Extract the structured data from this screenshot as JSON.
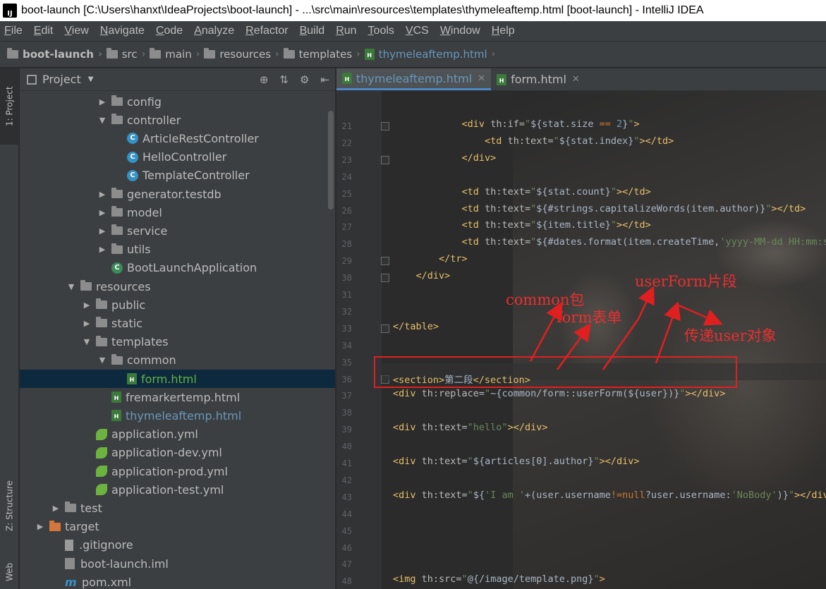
{
  "window": {
    "title": "boot-launch [C:\\Users\\hanxt\\IdeaProjects\\boot-launch] - ...\\src\\main\\resources\\templates\\thymeleaftemp.html [boot-launch] - IntelliJ IDEA"
  },
  "menu": [
    "File",
    "Edit",
    "View",
    "Navigate",
    "Code",
    "Analyze",
    "Refactor",
    "Build",
    "Run",
    "Tools",
    "VCS",
    "Window",
    "Help"
  ],
  "breadcrumb": [
    "boot-launch",
    "src",
    "main",
    "resources",
    "templates",
    "thymeleaftemp.html"
  ],
  "sidebar_tabs": {
    "project": "1: Project",
    "structure": "Z: Structure",
    "web": "Web"
  },
  "project_panel": {
    "title": "Project",
    "tree": [
      {
        "label": "config",
        "type": "folder",
        "depth": 5,
        "expanded": false
      },
      {
        "label": "controller",
        "type": "folder",
        "depth": 5,
        "expanded": true
      },
      {
        "label": "ArticleRestController",
        "type": "class",
        "depth": 6
      },
      {
        "label": "HelloController",
        "type": "class",
        "depth": 6
      },
      {
        "label": "TemplateController",
        "type": "class",
        "depth": 6
      },
      {
        "label": "generator.testdb",
        "type": "folder",
        "depth": 5,
        "expanded": false
      },
      {
        "label": "model",
        "type": "folder",
        "depth": 5,
        "expanded": false
      },
      {
        "label": "service",
        "type": "folder",
        "depth": 5,
        "expanded": false
      },
      {
        "label": "utils",
        "type": "folder",
        "depth": 5,
        "expanded": false
      },
      {
        "label": "BootLaunchApplication",
        "type": "springclass",
        "depth": 5
      },
      {
        "label": "resources",
        "type": "resfolder",
        "depth": 3,
        "expanded": true
      },
      {
        "label": "public",
        "type": "folder",
        "depth": 4,
        "expanded": false
      },
      {
        "label": "static",
        "type": "folder",
        "depth": 4,
        "expanded": false
      },
      {
        "label": "templates",
        "type": "folder",
        "depth": 4,
        "expanded": true
      },
      {
        "label": "common",
        "type": "folder",
        "depth": 5,
        "expanded": true
      },
      {
        "label": "form.html",
        "type": "html",
        "depth": 6,
        "selected": true
      },
      {
        "label": "fremarkertemp.html",
        "type": "html",
        "depth": 5
      },
      {
        "label": "thymeleaftemp.html",
        "type": "html",
        "depth": 5,
        "open": true
      },
      {
        "label": "application.yml",
        "type": "yml",
        "depth": 4
      },
      {
        "label": "application-dev.yml",
        "type": "yml",
        "depth": 4
      },
      {
        "label": "application-prod.yml",
        "type": "yml",
        "depth": 4
      },
      {
        "label": "application-test.yml",
        "type": "yml",
        "depth": 4
      },
      {
        "label": "test",
        "type": "folder",
        "depth": 2,
        "expanded": false
      },
      {
        "label": "target",
        "type": "orangefolder",
        "depth": 1,
        "expanded": false
      },
      {
        "label": ".gitignore",
        "type": "git",
        "depth": 2
      },
      {
        "label": "boot-launch.iml",
        "type": "iml",
        "depth": 2
      },
      {
        "label": "pom.xml",
        "type": "maven",
        "depth": 2
      }
    ]
  },
  "editor": {
    "tabs": [
      {
        "label": "thymeleaftemp.html",
        "active": true
      },
      {
        "label": "form.html",
        "active": false
      }
    ],
    "lines": [
      {
        "n": "21",
        "indent": "            ",
        "tokens": [
          [
            "tg",
            "<div "
          ],
          [
            "at",
            "th:if="
          ],
          [
            "st",
            "\""
          ],
          [
            "ex",
            "${stat.size "
          ],
          [
            "kw",
            "=="
          ],
          [
            "lit",
            " 2"
          ],
          [
            "ex",
            "}"
          ],
          [
            "st",
            "\""
          ],
          [
            "tg",
            ">"
          ]
        ]
      },
      {
        "n": "22",
        "indent": "                ",
        "tokens": [
          [
            "tg",
            "<td "
          ],
          [
            "at",
            "th:text="
          ],
          [
            "st",
            "\""
          ],
          [
            "ex",
            "${stat.index}"
          ],
          [
            "st",
            "\""
          ],
          [
            "tg",
            "></td>"
          ]
        ]
      },
      {
        "n": "23",
        "indent": "            ",
        "tokens": [
          [
            "tg",
            "</div>"
          ]
        ]
      },
      {
        "n": "24",
        "indent": "",
        "tokens": []
      },
      {
        "n": "25",
        "indent": "            ",
        "tokens": [
          [
            "tg",
            "<td "
          ],
          [
            "at",
            "th:text="
          ],
          [
            "st",
            "\""
          ],
          [
            "ex",
            "${stat.count}"
          ],
          [
            "st",
            "\""
          ],
          [
            "tg",
            "></td>"
          ]
        ]
      },
      {
        "n": "26",
        "indent": "            ",
        "tokens": [
          [
            "tg",
            "<td "
          ],
          [
            "at",
            "th:text="
          ],
          [
            "st",
            "\""
          ],
          [
            "ex",
            "${#strings.capitalizeWords(item.author)}"
          ],
          [
            "st",
            "\""
          ],
          [
            "tg",
            "></td>"
          ]
        ]
      },
      {
        "n": "27",
        "indent": "            ",
        "tokens": [
          [
            "tg",
            "<td "
          ],
          [
            "at",
            "th:text="
          ],
          [
            "st",
            "\""
          ],
          [
            "ex",
            "${item.title}"
          ],
          [
            "st",
            "\""
          ],
          [
            "tg",
            "></td>"
          ]
        ]
      },
      {
        "n": "28",
        "indent": "            ",
        "tokens": [
          [
            "tg",
            "<td "
          ],
          [
            "at",
            "th:text="
          ],
          [
            "st",
            "\""
          ],
          [
            "ex",
            "${#dates.format(item.createTime,"
          ],
          [
            "st",
            "'yyyy-MM-dd HH:mm:ss"
          ]
        ]
      },
      {
        "n": "29",
        "indent": "        ",
        "tokens": [
          [
            "tg",
            "</tr>"
          ]
        ]
      },
      {
        "n": "30",
        "indent": "    ",
        "tokens": [
          [
            "tg",
            "</div>"
          ]
        ]
      },
      {
        "n": "31",
        "indent": "",
        "tokens": []
      },
      {
        "n": "32",
        "indent": "",
        "tokens": []
      },
      {
        "n": "33",
        "indent": "",
        "tokens": [
          [
            "tg",
            "</table>"
          ]
        ]
      },
      {
        "n": "34",
        "indent": "",
        "tokens": []
      },
      {
        "n": "35",
        "indent": "",
        "tokens": []
      },
      {
        "n": "36",
        "indent": "",
        "tokens": [
          [
            "tg",
            "<section>"
          ],
          [
            "ex",
            "第二段"
          ],
          [
            "tg",
            "</section>"
          ]
        ]
      },
      {
        "n": "37",
        "indent": "",
        "tokens": [
          [
            "tg",
            "<div "
          ],
          [
            "at",
            "th:replace="
          ],
          [
            "st",
            "\""
          ],
          [
            "ex",
            "~{common/form::userForm(${user})}"
          ],
          [
            "st",
            "\""
          ],
          [
            "tg",
            "></div>"
          ]
        ]
      },
      {
        "n": "38",
        "indent": "",
        "tokens": []
      },
      {
        "n": "39",
        "indent": "",
        "tokens": [
          [
            "tg",
            "<div "
          ],
          [
            "at",
            "th:text="
          ],
          [
            "st",
            "\"hello\""
          ],
          [
            "tg",
            "></div>"
          ]
        ]
      },
      {
        "n": "40",
        "indent": "",
        "tokens": []
      },
      {
        "n": "41",
        "indent": "",
        "tokens": [
          [
            "tg",
            "<div "
          ],
          [
            "at",
            "th:text="
          ],
          [
            "st",
            "\""
          ],
          [
            "ex",
            "${articles[0].author}"
          ],
          [
            "st",
            "\""
          ],
          [
            "tg",
            "></div>"
          ]
        ]
      },
      {
        "n": "42",
        "indent": "",
        "tokens": []
      },
      {
        "n": "43",
        "indent": "",
        "tokens": [
          [
            "tg",
            "<div "
          ],
          [
            "at",
            "th:text="
          ],
          [
            "st",
            "\""
          ],
          [
            "ex",
            "${"
          ],
          [
            "st",
            "'I am '"
          ],
          [
            "ex",
            "+(user.username"
          ],
          [
            "kw",
            "!=null"
          ],
          [
            "ex",
            "?user.username:"
          ],
          [
            "st",
            "'NoBody'"
          ],
          [
            "ex",
            ")}"
          ],
          [
            "st",
            "\""
          ],
          [
            "tg",
            "></div>"
          ]
        ]
      },
      {
        "n": "44",
        "indent": "",
        "tokens": []
      },
      {
        "n": "45",
        "indent": "",
        "tokens": []
      },
      {
        "n": "46",
        "indent": "",
        "tokens": []
      },
      {
        "n": "47",
        "indent": "",
        "tokens": []
      },
      {
        "n": "48",
        "indent": "",
        "tokens": [
          [
            "tg",
            "<img "
          ],
          [
            "at",
            "th:src="
          ],
          [
            "st",
            "\""
          ],
          [
            "ex",
            "@{/image/template.png}"
          ],
          [
            "st",
            "\""
          ],
          [
            "tg",
            ">"
          ]
        ]
      },
      {
        "n": "49",
        "indent": "",
        "tokens": []
      }
    ]
  },
  "annotations": {
    "common": "common包",
    "form": "form表单",
    "userForm": "userForm片段",
    "user": "传递user对象"
  },
  "colors": {
    "accent": "#4a88c7",
    "annotation": "#e02020"
  }
}
